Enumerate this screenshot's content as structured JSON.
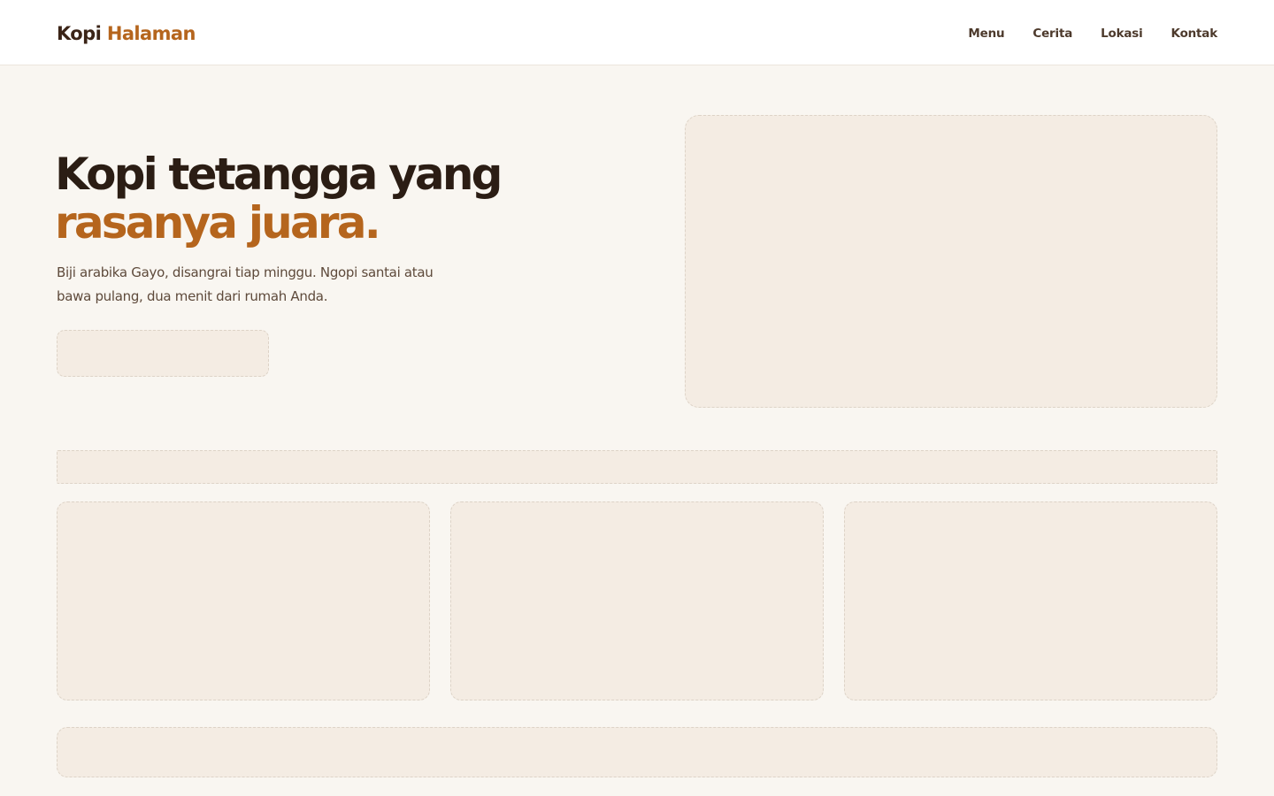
{
  "brand": {
    "part1": "Kopi",
    "part2": "Halaman",
    "color_primary": "#3b2417",
    "color_accent": "#b5651d"
  },
  "nav": {
    "items": [
      {
        "label": "Menu"
      },
      {
        "label": "Cerita"
      },
      {
        "label": "Lokasi"
      },
      {
        "label": "Kontak"
      }
    ]
  },
  "hero": {
    "title_line1": "Kopi tetangga yang",
    "title_line2": "rasanya juara.",
    "subtitle": "Biji arabika Gayo, disangrai tiap minggu. Ngopi santai atau bawa pulang, dua menit dari rumah Anda."
  },
  "colors": {
    "page_background": "#f9f6f1",
    "placeholder_fill": "#f4ece3",
    "placeholder_border": "#ddd3c7"
  }
}
